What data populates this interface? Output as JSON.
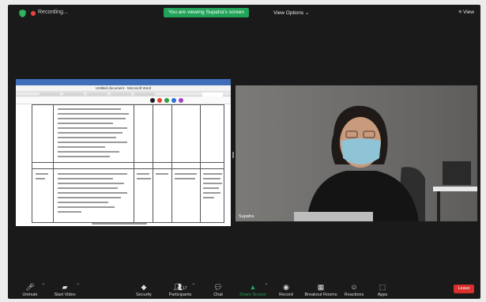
{
  "topbar": {
    "recording_label": "Recording...",
    "share_banner": "You are viewing Supatra's screen",
    "view_options": "View Options ⌄",
    "view_button": "≡ View"
  },
  "shared_screen": {
    "document_title": "Untitled document - Microsoft Word",
    "pen_colors": [
      "#1b1b1b",
      "#e63b2e",
      "#2e9e47",
      "#2f6fd0",
      "#9b3fc4"
    ]
  },
  "camera": {
    "participant_name": "Supatra"
  },
  "toolbar": {
    "items": [
      {
        "label": "Unmute",
        "icon": "mic-muted-icon"
      },
      {
        "label": "Start Video",
        "icon": "video-off-icon"
      },
      {
        "label": "Security",
        "icon": "shield-icon"
      },
      {
        "label": "Participants",
        "icon": "participants-icon",
        "count": "17"
      },
      {
        "label": "Chat",
        "icon": "chat-icon"
      },
      {
        "label": "Share Screen",
        "icon": "share-screen-icon"
      },
      {
        "label": "Record",
        "icon": "record-icon"
      },
      {
        "label": "Breakout Rooms",
        "icon": "breakout-rooms-icon"
      },
      {
        "label": "Reactions",
        "icon": "reactions-icon"
      },
      {
        "label": "Apps",
        "icon": "apps-icon"
      }
    ],
    "leave_label": "Leave"
  }
}
